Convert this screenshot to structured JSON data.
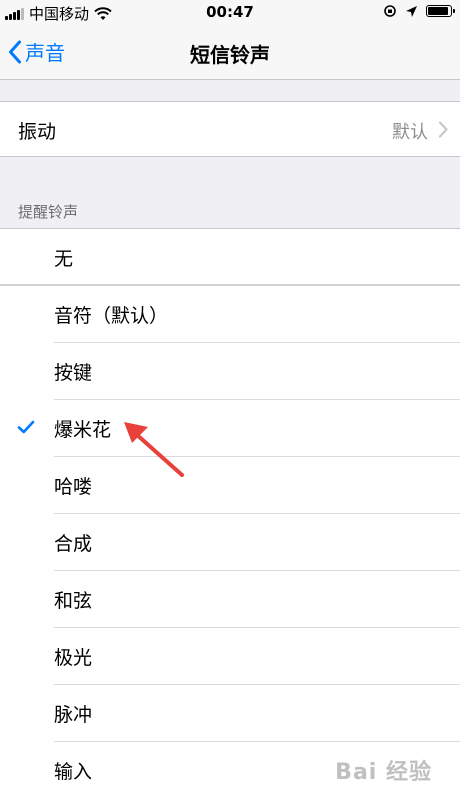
{
  "status_bar": {
    "carrier": "中国移动",
    "time": "00:47",
    "battery_level": 0.9
  },
  "nav": {
    "back_label": "声音",
    "title": "短信铃声"
  },
  "vibration": {
    "label": "振动",
    "value": "默认"
  },
  "alert_tones": {
    "header": "提醒铃声",
    "items": [
      {
        "label": "无",
        "selected": false
      },
      {
        "label": "音符（默认）",
        "selected": false
      },
      {
        "label": "按键",
        "selected": false
      },
      {
        "label": "爆米花",
        "selected": true
      },
      {
        "label": "哈喽",
        "selected": false
      },
      {
        "label": "合成",
        "selected": false
      },
      {
        "label": "和弦",
        "selected": false
      },
      {
        "label": "极光",
        "selected": false
      },
      {
        "label": "脉冲",
        "selected": false
      },
      {
        "label": "输入",
        "selected": false
      }
    ]
  },
  "watermark": {
    "text": "Bai 经验"
  },
  "colors": {
    "accent": "#007aff",
    "annotation_arrow": "#e8403a"
  }
}
